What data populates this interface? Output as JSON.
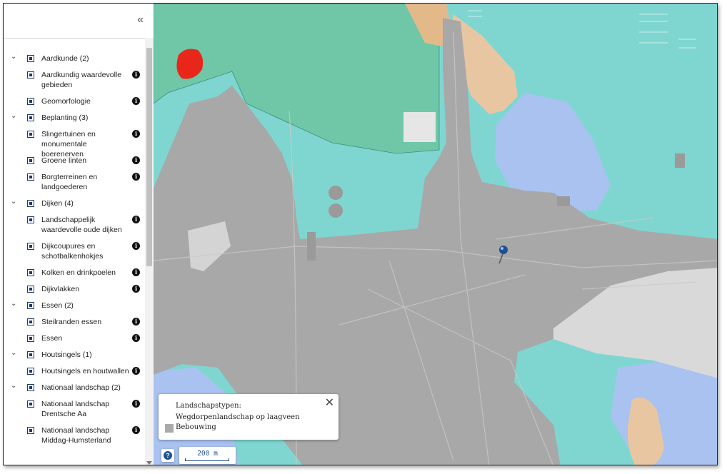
{
  "sidebar": {
    "collapse_label": "«",
    "groups": [
      {
        "label": "Aardkunde (2)",
        "items": [
          {
            "label": "Aardkundig waardevolle gebieden",
            "lines": [
              "Aardkundig waardevolle",
              "gebieden"
            ]
          },
          {
            "label": "Geomorfologie",
            "lines": [
              "Geomorfologie"
            ]
          }
        ]
      },
      {
        "label": "Beplanting (3)",
        "items": [
          {
            "label": "Slingertuinen en monumentale boerenerven",
            "lines": [
              "Slingertuinen en",
              "monumentale boerenerven"
            ]
          },
          {
            "label": "Groene linten",
            "lines": [
              "Groene linten"
            ]
          },
          {
            "label": "Borgterreinen en landgoederen",
            "lines": [
              "Borgterreinen en",
              "landgoederen"
            ]
          }
        ]
      },
      {
        "label": "Dijken (4)",
        "items": [
          {
            "label": "Landschappelijk waardevolle oude dijken",
            "lines": [
              "Landschappelijk",
              "waardevolle oude dijken"
            ]
          },
          {
            "label": "Dijkcoupures en schotbalkenhokjes",
            "lines": [
              "Dijkcoupures en",
              "schotbalkenhokjes"
            ]
          },
          {
            "label": "Kolken en drinkpoelen",
            "lines": [
              "Kolken en drinkpoelen"
            ]
          },
          {
            "label": "Dijkvlakken",
            "lines": [
              "Dijkvlakken"
            ]
          }
        ]
      },
      {
        "label": "Essen (2)",
        "items": [
          {
            "label": "Steilranden essen",
            "lines": [
              "Steilranden essen"
            ]
          },
          {
            "label": "Essen",
            "lines": [
              "Essen"
            ]
          }
        ]
      },
      {
        "label": "Houtsingels (1)",
        "items": [
          {
            "label": "Houtsingels en houtwallen",
            "lines": [
              "Houtsingels en houtwallen"
            ]
          }
        ]
      },
      {
        "label": "Nationaal landschap (2)",
        "items": [
          {
            "label": "Nationaal landschap Drentsche Aa",
            "lines": [
              "Nationaal landschap",
              "Drentsche Aa"
            ]
          },
          {
            "label": "Nationaal landschap Middag-Humsterland",
            "lines": [
              "Nationaal landschap",
              "Middag-Humsterland"
            ]
          }
        ]
      }
    ],
    "info_glyph": "i",
    "chevron_glyph": "⌄"
  },
  "map": {
    "popup": {
      "title": "Landschapstypen: Wegdorpenlandschap op laagveen",
      "legend_item": "Bebouwing",
      "legend_color": "#aaaaaa",
      "close_glyph": "✕"
    },
    "help_glyph": "?",
    "scale_label": "200 m"
  },
  "colors": {
    "water_turquoise": "#7fd6d1",
    "built_gray": "#a8a8a8",
    "green_area": "#6fc7a8",
    "blue_area": "#a9c2f0",
    "orange_area": "#e9c6a2",
    "red_area": "#e8261a",
    "accent_blue": "#1d4f91"
  }
}
